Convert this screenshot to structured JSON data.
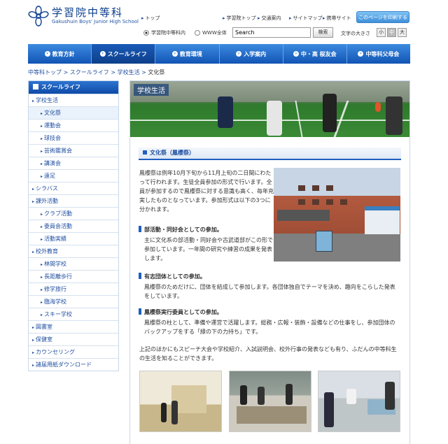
{
  "header": {
    "logo_jp": "学習院中等科",
    "logo_en": "Gakushuin Boys' Junior High School",
    "links": [
      "トップ",
      "学習院トップ",
      "交通案内",
      "サイトマップ",
      "携帯サイト"
    ],
    "print_button": "このページを印刷する",
    "search_scope": [
      "学習院中等科内",
      "WWW全体"
    ],
    "search_value": "Search",
    "search_button": "検索",
    "font_size_label": "文字の大きさ",
    "font_sizes": [
      "小",
      "中",
      "大"
    ]
  },
  "nav": {
    "items": [
      "教育方針",
      "スクールライフ",
      "教育環境",
      "入学案内",
      "中・高 桜友会",
      "中等科父母会"
    ]
  },
  "breadcrumb": {
    "items": [
      "中等科トップ",
      "スクールライフ",
      "学校生活"
    ],
    "current": "文化祭"
  },
  "sidebar": {
    "title": "スクールライフ",
    "items": [
      {
        "label": "学校生活",
        "level": 0
      },
      {
        "label": "文化祭",
        "level": 1
      },
      {
        "label": "運動会",
        "level": 1
      },
      {
        "label": "球技会",
        "level": 1
      },
      {
        "label": "芸術鑑賞会",
        "level": 1
      },
      {
        "label": "講演会",
        "level": 1
      },
      {
        "label": "遠足",
        "level": 1
      },
      {
        "label": "シラバス",
        "level": 0
      },
      {
        "label": "課外活動",
        "level": 0
      },
      {
        "label": "クラブ活動",
        "level": 1
      },
      {
        "label": "委員会活動",
        "level": 1
      },
      {
        "label": "活動実績",
        "level": 1
      },
      {
        "label": "校外教育",
        "level": 0
      },
      {
        "label": "林間学校",
        "level": 1
      },
      {
        "label": "長距離歩行",
        "level": 1
      },
      {
        "label": "修学旅行",
        "level": 1
      },
      {
        "label": "臨海学校",
        "level": 1
      },
      {
        "label": "スキー学校",
        "level": 1
      },
      {
        "label": "図書室",
        "level": 0
      },
      {
        "label": "保健室",
        "level": 0
      },
      {
        "label": "カウンセリング",
        "level": 0
      },
      {
        "label": "諸届用紙ダウンロード",
        "level": 0
      }
    ]
  },
  "main": {
    "hero_title": "学校生活",
    "section_title": "文化祭（鳳櫻祭）",
    "intro": "鳳櫻祭は例年10月下旬から11月上旬の二日間にわたって行われます。生徒全員参加の形式で行います。全員が参加するので鳳櫻祭に対する意識も高く、毎年充実したものとなっています。参加形式は以下の3つに分かれます。",
    "items": [
      {
        "head": "部活動・同好会としての参加。",
        "body": "主に文化系の部活動・同好会や古武道部がこの形で参加しています。一年間の研究や練習の成果を発表します。"
      },
      {
        "head": "有志団体としての参加。",
        "body": "鳳櫻祭のためだけに、団体を結成して参加します。各団体独自でテーマを決め、趣向をこらした発表をしています。"
      },
      {
        "head": "鳳櫻祭実行委員としての参加。",
        "body": "鳳櫻祭の柱として、準備や運営で活躍します。総務・広報・装飾・設備などの仕事をし、参加団体のバックアップをする「縁の下の力持ち」です。"
      }
    ],
    "outro": "上記のほかにもスピーチ大会や学校紹介、入試説明会、校外行事の発表なども有り、ふだんの中等科生の生活を知ることができます。"
  },
  "colors": {
    "brand": "#1254b4",
    "link": "#1f4ea0"
  }
}
